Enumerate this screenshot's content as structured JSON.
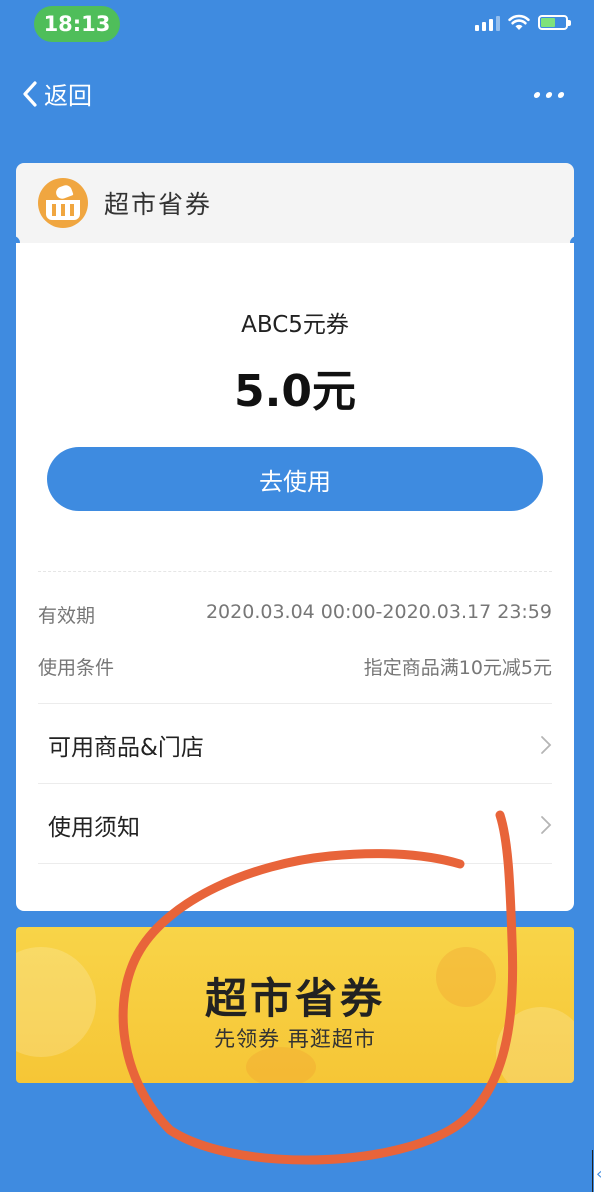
{
  "status_bar": {
    "time": "18:13"
  },
  "nav": {
    "back_label": "返回"
  },
  "card": {
    "header_title": "超市省券",
    "coupon_name": "ABC5元券",
    "coupon_value": "5.0元",
    "use_button_label": "去使用",
    "info": [
      {
        "label": "有效期",
        "value": "2020.03.04 00:00-2020.03.17 23:59"
      },
      {
        "label": "使用条件",
        "value": "指定商品满10元减5元"
      }
    ],
    "links": [
      {
        "label": "可用商品&门店"
      },
      {
        "label": "使用须知"
      }
    ]
  },
  "banner": {
    "title": "超市省券",
    "subtitle": "先领券 再逛超市"
  },
  "colors": {
    "background": "#3f8be0",
    "accent_button": "#3e8be0",
    "banner": "#f6c636",
    "annotation_stroke": "#e8643a",
    "time_pill": "#4fbe5a"
  },
  "icons": [
    "back-chevron-icon",
    "more-icon",
    "signal-icon",
    "wifi-icon",
    "battery-icon",
    "supermarket-logo-icon",
    "chevron-right-icon"
  ]
}
